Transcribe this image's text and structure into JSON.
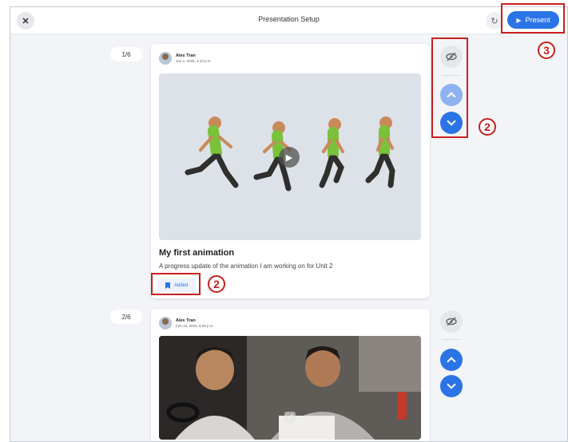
{
  "header": {
    "title": "Presentation Setup",
    "close_icon": "close-icon",
    "refresh_icon": "refresh-icon",
    "present_label": "Present",
    "play_icon": "play-icon"
  },
  "annotations": {
    "marker_2": "2",
    "marker_3": "3"
  },
  "posts": [
    {
      "counter": "1/6",
      "author": "Alex Tran",
      "date": "Jan 2, 2025, 4:43 p.m.",
      "title": "My first animation",
      "description": "A progress update of the animation I am working on for Unit 2",
      "added_label": "Added",
      "media": "animation-video"
    },
    {
      "counter": "2/6",
      "author": "Alex Tran",
      "date": "Feb 15, 2025, 8:39 p.m.",
      "media": "photo"
    }
  ],
  "colors": {
    "accent": "#2a74e6",
    "annotation_red": "#c8201e",
    "background": "#f2f4f7"
  }
}
